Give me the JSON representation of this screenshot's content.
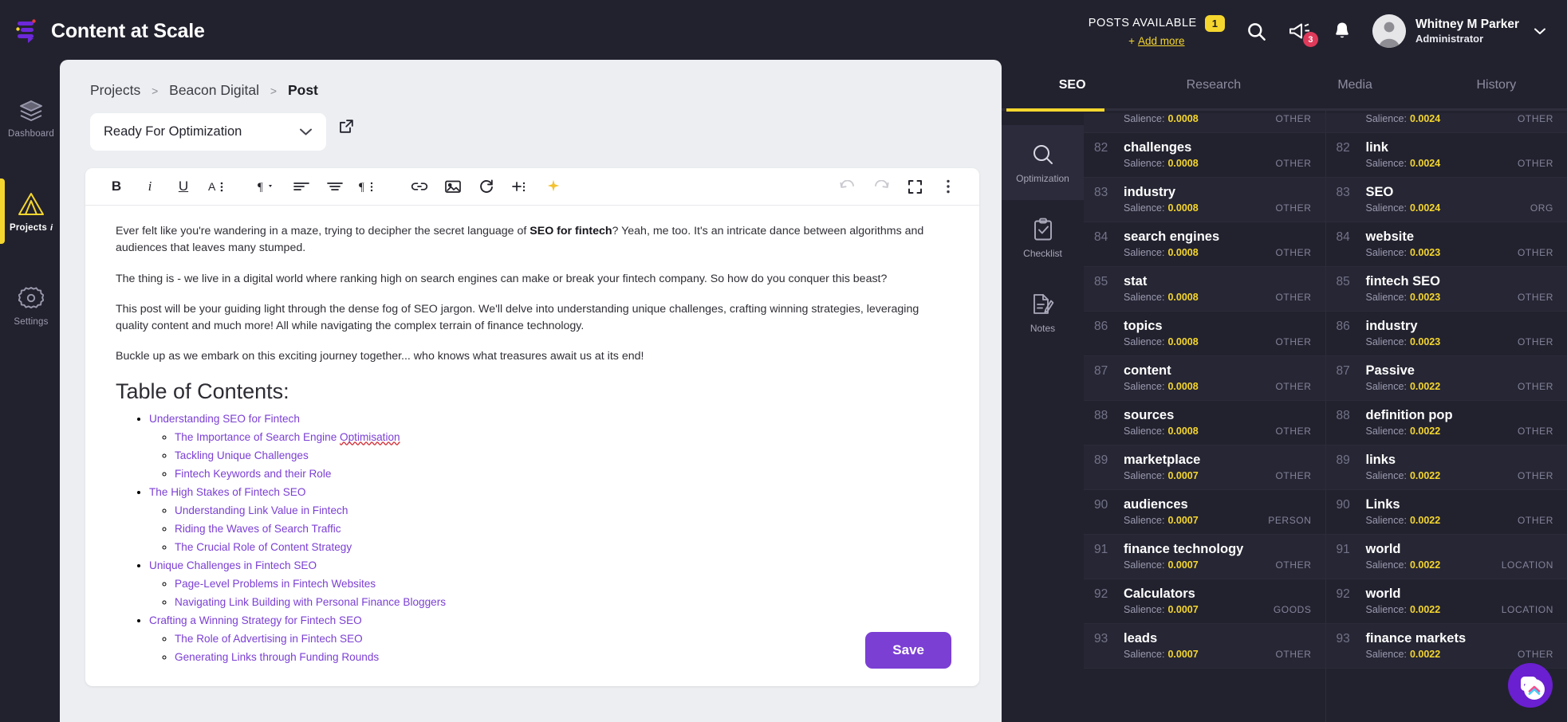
{
  "header": {
    "brand": "Content at Scale",
    "posts_label": "POSTS AVAILABLE",
    "posts_count": "1",
    "add_more": "Add more",
    "add_more_plus": "+",
    "megaphone_badge": "3",
    "user_name": "Whitney M Parker",
    "user_role": "Administrator",
    "accent_yellow": "#f5d62e",
    "badge_red": "#e03a5a"
  },
  "rail": {
    "items": [
      {
        "label": "Dashboard",
        "icon": "layers-icon",
        "active": false
      },
      {
        "label": "Projects",
        "icon": "triangle-icon",
        "active": true,
        "info": "i"
      },
      {
        "label": "Settings",
        "icon": "gear-icon",
        "active": false
      }
    ]
  },
  "modal": {
    "breadcrumb": {
      "root": "Projects",
      "project": "Beacon Digital",
      "current": "Post",
      "separator": ">"
    },
    "status_select": {
      "value": "Ready For Optimization"
    },
    "save_label": "Save",
    "toolbar": {
      "bold": "B",
      "italic": "i",
      "underline": "U",
      "font_size": "A",
      "paragraph": "¶",
      "align_left": "align-left",
      "align_center": "align-center",
      "paragraph_style": "¶",
      "link": "link",
      "image": "image",
      "regenerate": "regenerate",
      "insert": "+",
      "sparkle": "✦",
      "undo": "undo",
      "redo": "redo",
      "fullscreen": "fullscreen",
      "more": "more"
    },
    "document": {
      "paragraphs": [
        {
          "pre": "Ever felt like you're wandering in a maze, trying to decipher the secret language of ",
          "bold": "SEO for fintech",
          "post": "? Yeah, me too. It's an intricate dance between algorithms and audiences that leaves many stumped."
        },
        {
          "pre": "The thing is - we live in a digital world where ranking high on search engines can make or break your fintech company. So how do you conquer this beast?",
          "bold": "",
          "post": ""
        },
        {
          "pre": "This post will be your guiding light through the dense fog of SEO jargon. We'll delve into understanding unique challenges, crafting winning strategies, leveraging quality content and much more! All while navigating the complex terrain of finance technology.",
          "bold": "",
          "post": ""
        },
        {
          "pre": "Buckle up as we embark on this exciting journey together... who knows what treasures await us at its end!",
          "bold": "",
          "post": ""
        }
      ],
      "toc_heading": "Table of Contents:",
      "toc": [
        {
          "label": "Understanding SEO for Fintech",
          "children": [
            {
              "label": "The Importance of Search Engine Optimisation",
              "misspelled": "Optimisation"
            },
            {
              "label": "Tackling Unique Challenges"
            },
            {
              "label": "Fintech Keywords and their Role"
            }
          ]
        },
        {
          "label": "The High Stakes of Fintech SEO",
          "children": [
            {
              "label": "Understanding Link Value in Fintech"
            },
            {
              "label": "Riding the Waves of Search Traffic"
            },
            {
              "label": "The Crucial Role of Content Strategy"
            }
          ]
        },
        {
          "label": "Unique Challenges in Fintech SEO",
          "children": [
            {
              "label": "Page-Level Problems in Fintech Websites"
            },
            {
              "label": "Navigating Link Building with Personal Finance Bloggers"
            }
          ]
        },
        {
          "label": "Crafting a Winning Strategy for Fintech SEO",
          "children": [
            {
              "label": "The Role of Advertising in Fintech SEO"
            },
            {
              "label": "Generating Links through Funding Rounds"
            }
          ]
        }
      ]
    }
  },
  "right_panel": {
    "tabs": [
      {
        "label": "SEO",
        "active": true
      },
      {
        "label": "Research",
        "active": false
      },
      {
        "label": "Media",
        "active": false
      },
      {
        "label": "History",
        "active": false
      }
    ],
    "vrail": [
      {
        "label": "Optimization",
        "icon": "magnifier-icon",
        "active": true
      },
      {
        "label": "Checklist",
        "icon": "clipboard-check-icon",
        "active": false
      },
      {
        "label": "Notes",
        "icon": "note-pen-icon",
        "active": false
      }
    ],
    "salience_label": "Salience:",
    "columns": [
      {
        "name": "keywords-column-left",
        "rows": [
          {
            "rank": "",
            "term": "",
            "salience": "0.0008",
            "type": "OTHER",
            "partial": true
          },
          {
            "rank": "82",
            "term": "challenges",
            "salience": "0.0008",
            "type": "OTHER"
          },
          {
            "rank": "83",
            "term": "industry",
            "salience": "0.0008",
            "type": "OTHER"
          },
          {
            "rank": "84",
            "term": "search engines",
            "salience": "0.0008",
            "type": "OTHER"
          },
          {
            "rank": "85",
            "term": "stat",
            "salience": "0.0008",
            "type": "OTHER"
          },
          {
            "rank": "86",
            "term": "topics",
            "salience": "0.0008",
            "type": "OTHER"
          },
          {
            "rank": "87",
            "term": "content",
            "salience": "0.0008",
            "type": "OTHER"
          },
          {
            "rank": "88",
            "term": "sources",
            "salience": "0.0008",
            "type": "OTHER"
          },
          {
            "rank": "89",
            "term": "marketplace",
            "salience": "0.0007",
            "type": "OTHER"
          },
          {
            "rank": "90",
            "term": "audiences",
            "salience": "0.0007",
            "type": "PERSON"
          },
          {
            "rank": "91",
            "term": "finance technology",
            "salience": "0.0007",
            "type": "OTHER"
          },
          {
            "rank": "92",
            "term": "Calculators",
            "salience": "0.0007",
            "type": "GOODS"
          },
          {
            "rank": "93",
            "term": "leads",
            "salience": "0.0007",
            "type": "OTHER"
          }
        ]
      },
      {
        "name": "keywords-column-right",
        "rows": [
          {
            "rank": "",
            "term": "",
            "salience": "0.0024",
            "type": "OTHER",
            "partial": true
          },
          {
            "rank": "82",
            "term": "link",
            "salience": "0.0024",
            "type": "OTHER"
          },
          {
            "rank": "83",
            "term": "SEO",
            "salience": "0.0024",
            "type": "ORG"
          },
          {
            "rank": "84",
            "term": "website",
            "salience": "0.0023",
            "type": "OTHER"
          },
          {
            "rank": "85",
            "term": "fintech SEO",
            "salience": "0.0023",
            "type": "OTHER"
          },
          {
            "rank": "86",
            "term": "industry",
            "salience": "0.0023",
            "type": "OTHER"
          },
          {
            "rank": "87",
            "term": "Passive",
            "salience": "0.0022",
            "type": "OTHER"
          },
          {
            "rank": "88",
            "term": "definition pop",
            "salience": "0.0022",
            "type": "OTHER"
          },
          {
            "rank": "89",
            "term": "links",
            "salience": "0.0022",
            "type": "OTHER"
          },
          {
            "rank": "90",
            "term": "Links",
            "salience": "0.0022",
            "type": "OTHER"
          },
          {
            "rank": "91",
            "term": "world",
            "salience": "0.0022",
            "type": "LOCATION"
          },
          {
            "rank": "92",
            "term": "world",
            "salience": "0.0022",
            "type": "LOCATION"
          },
          {
            "rank": "93",
            "term": "finance markets",
            "salience": "0.0022",
            "type": "OTHER"
          }
        ]
      }
    ]
  }
}
